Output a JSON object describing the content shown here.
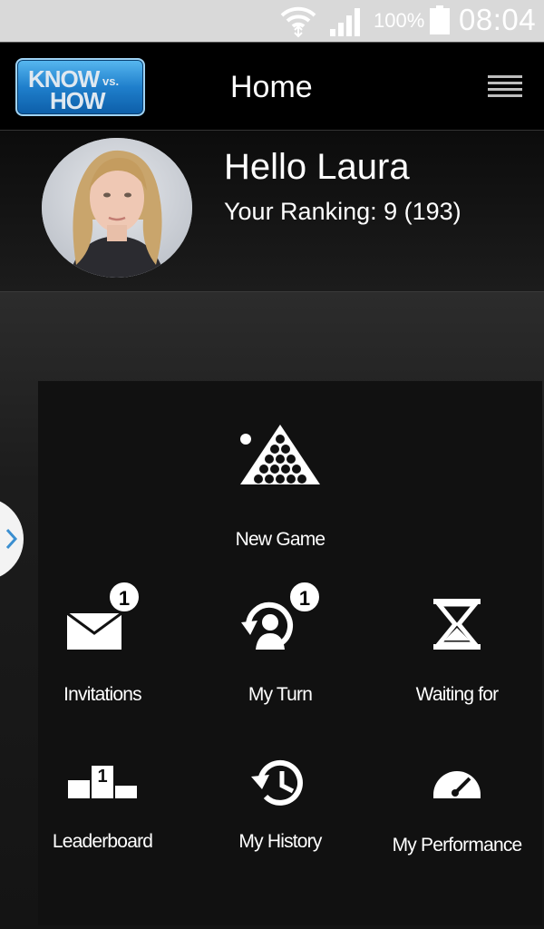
{
  "status_bar": {
    "battery_percent": "100%",
    "time": "08:04",
    "icons": [
      "wifi-icon",
      "signal-icon",
      "battery-icon"
    ]
  },
  "header": {
    "logo": {
      "line1": "KNOW",
      "vs": "vs.",
      "line2": "HOW"
    },
    "title": "Home",
    "menu_icon": "hamburger-menu-icon"
  },
  "profile": {
    "greeting": "Hello Laura",
    "ranking": "Your Ranking: 9 (193)"
  },
  "tiles": {
    "new_game": {
      "label": "New Game",
      "icon": "billiard-rack-icon"
    },
    "invitations": {
      "label": "Invitations",
      "icon": "envelope-icon",
      "badge": "1"
    },
    "my_turn": {
      "label": "My Turn",
      "icon": "player-turn-icon",
      "badge": "1"
    },
    "waiting_for": {
      "label": "Waiting for",
      "icon": "hourglass-icon"
    },
    "leaderboard": {
      "label": "Leaderboard",
      "icon": "podium-icon",
      "podium_number": "1"
    },
    "my_history": {
      "label": "My History",
      "icon": "history-clock-icon"
    },
    "my_performance": {
      "label": "My Performance",
      "icon": "speedometer-icon"
    }
  },
  "colors": {
    "logo_blue": "#1f7fcc",
    "background": "#141414",
    "text": "#ffffff"
  }
}
